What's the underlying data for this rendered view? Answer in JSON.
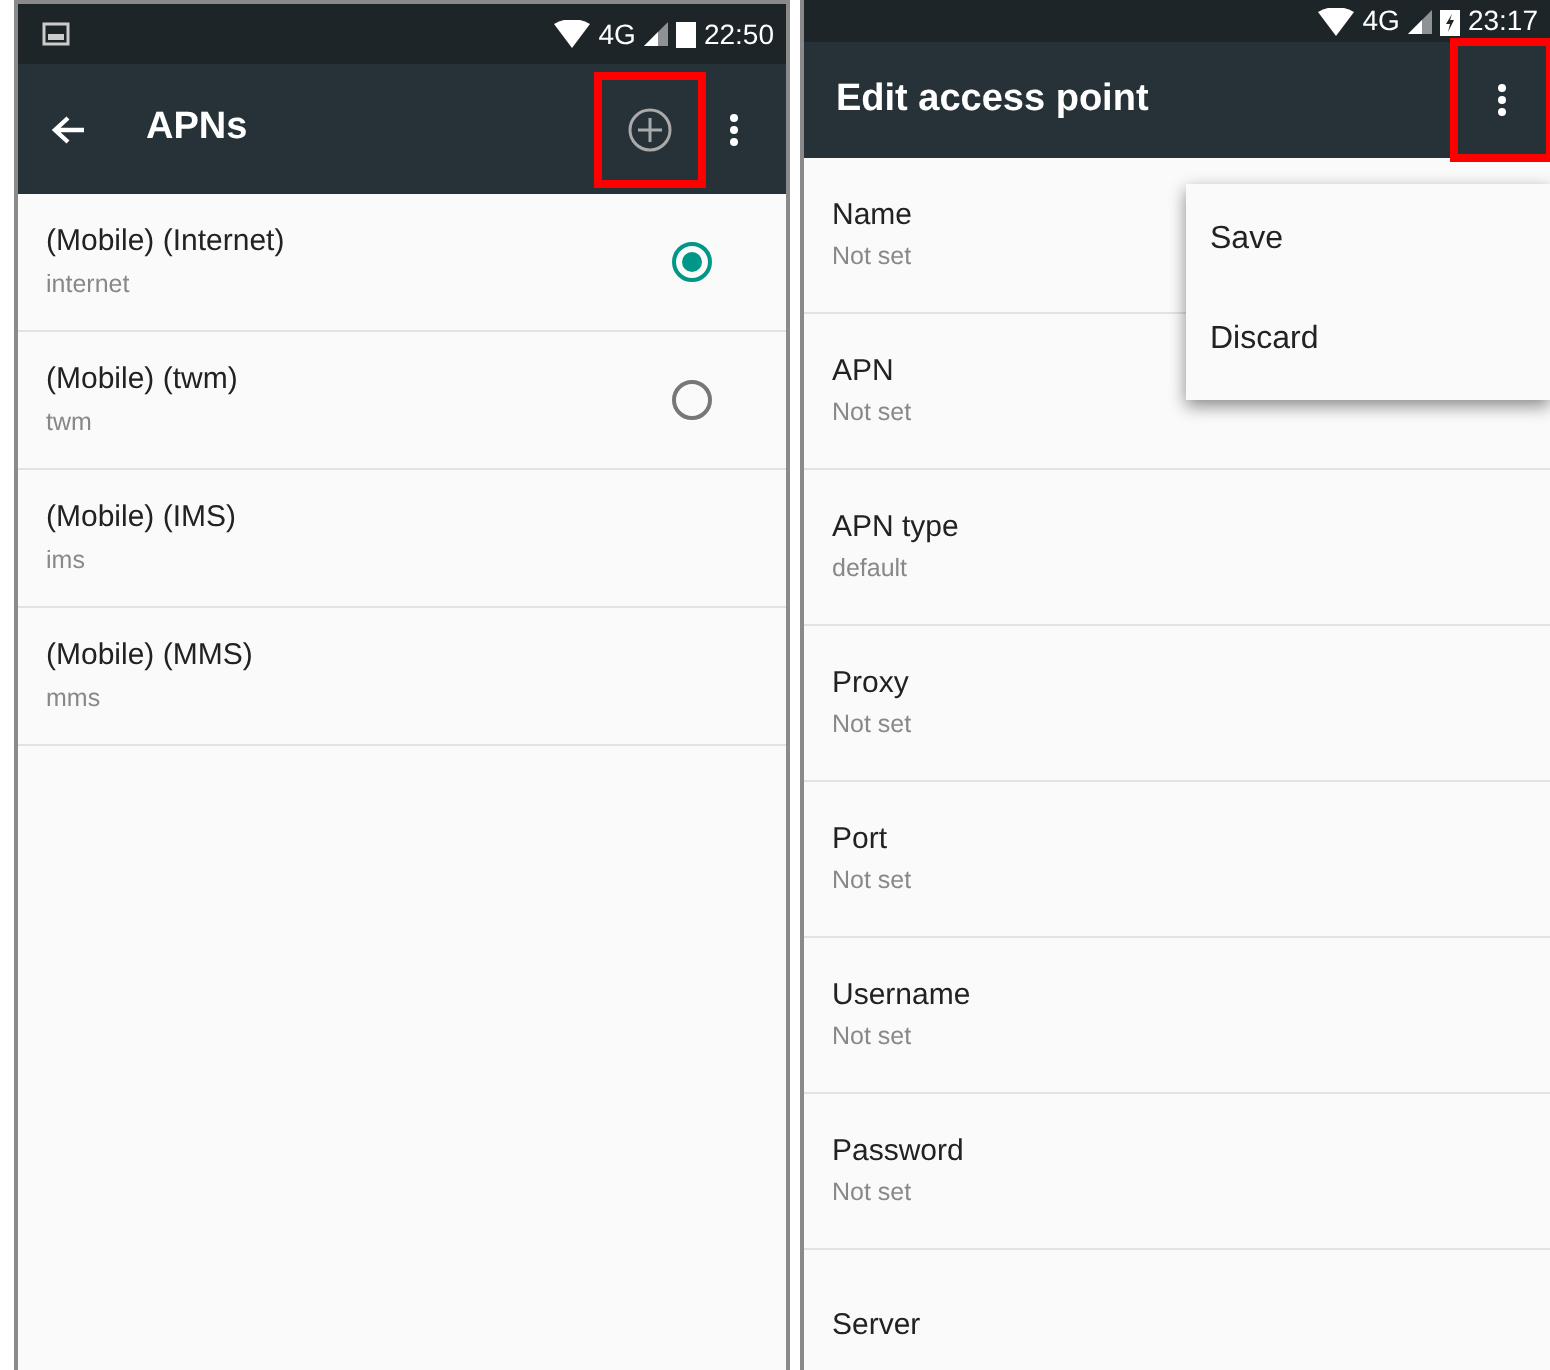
{
  "apn_list_screen": {
    "status_bar": {
      "network": "4G",
      "time": "22:50",
      "notification": true,
      "charging": false
    },
    "toolbar": {
      "title": "APNs",
      "add_highlighted": true,
      "menu_highlighted": false
    },
    "apns": [
      {
        "name": "(Mobile) (Internet)",
        "apn": "internet",
        "selected": true,
        "kind": "radio"
      },
      {
        "name": "(Mobile) (twm)",
        "apn": "twm",
        "selected": false,
        "kind": "radio"
      },
      {
        "name": "(Mobile) (IMS)",
        "apn": "ims",
        "kind": "plain"
      },
      {
        "name": "(Mobile) (MMS)",
        "apn": "mms",
        "kind": "plain"
      }
    ]
  },
  "edit_screen": {
    "status_bar": {
      "network": "4G",
      "time": "23:17",
      "notification": false,
      "charging": true
    },
    "toolbar": {
      "title": "Edit access point",
      "menu_highlighted": true
    },
    "fields": [
      {
        "label": "Name",
        "value": "Not set"
      },
      {
        "label": "APN",
        "value": "Not set"
      },
      {
        "label": "APN type",
        "value": "default"
      },
      {
        "label": "Proxy",
        "value": "Not set"
      },
      {
        "label": "Port",
        "value": "Not set"
      },
      {
        "label": "Username",
        "value": "Not set"
      },
      {
        "label": "Password",
        "value": "Not set"
      },
      {
        "label": "Server"
      }
    ],
    "menu": [
      "Save",
      "Discard"
    ]
  }
}
